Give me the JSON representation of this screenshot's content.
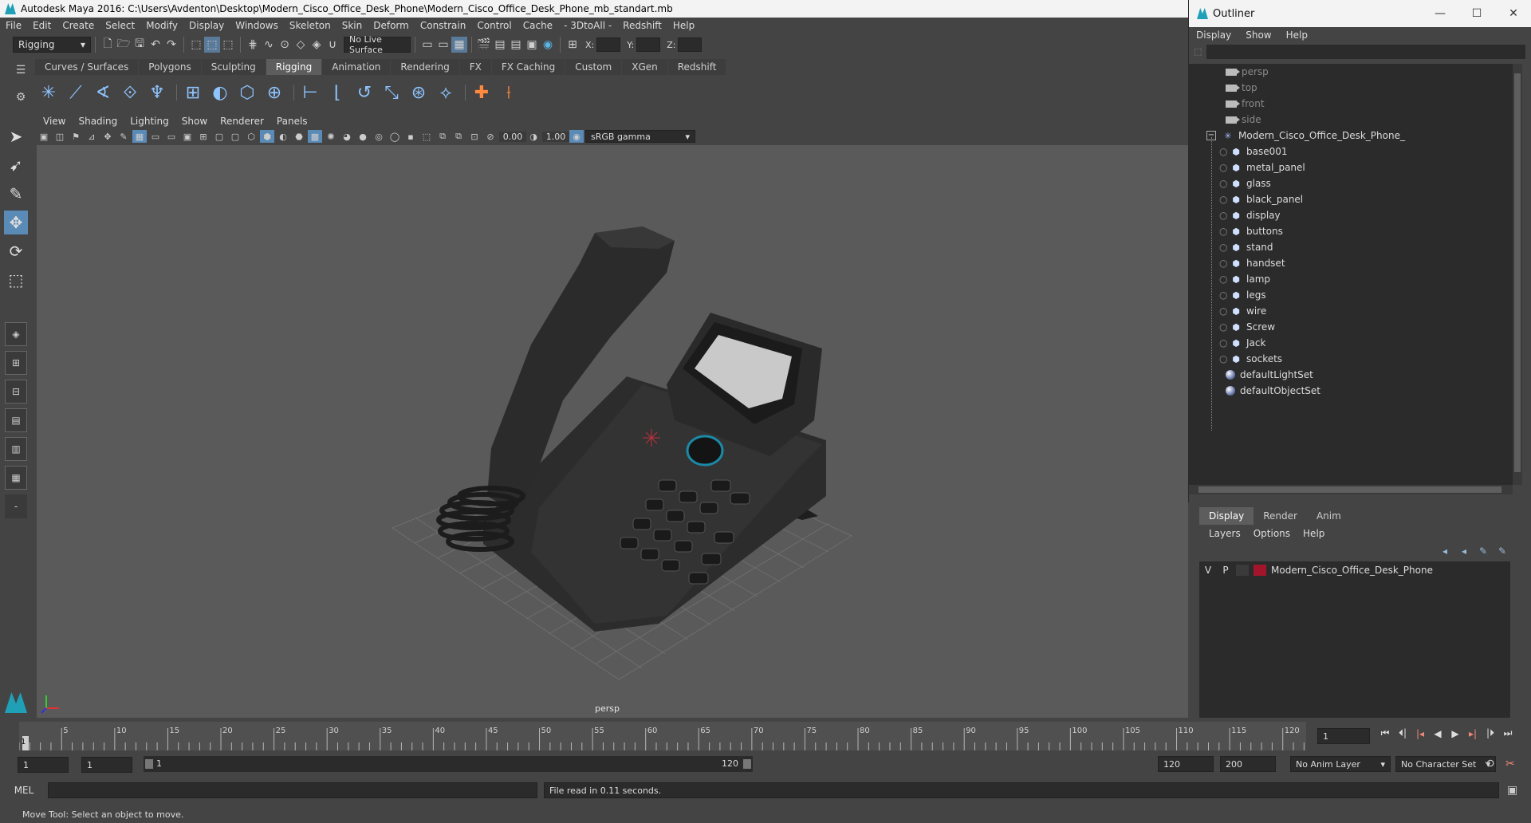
{
  "window": {
    "title": "Autodesk Maya 2016: C:\\Users\\Avdenton\\Desktop\\Modern_Cisco_Office_Desk_Phone\\Modern_Cisco_Office_Desk_Phone_mb_standart.mb"
  },
  "main_menu": [
    "File",
    "Edit",
    "Create",
    "Select",
    "Modify",
    "Display",
    "Windows",
    "Skeleton",
    "Skin",
    "Deform",
    "Constrain",
    "Control",
    "Cache",
    "- 3DtoAll -",
    "Redshift",
    "Help"
  ],
  "status_line": {
    "menu_set": "Rigging",
    "live_surface": "No Live Surface",
    "x_label": "X:",
    "y_label": "Y:",
    "z_label": "Z:"
  },
  "shelf_tabs": [
    "Curves / Surfaces",
    "Polygons",
    "Sculpting",
    "Rigging",
    "Animation",
    "Rendering",
    "FX",
    "FX Caching",
    "Custom",
    "XGen",
    "Redshift"
  ],
  "active_shelf_tab": "Rigging",
  "viewport": {
    "menu": [
      "View",
      "Shading",
      "Lighting",
      "Show",
      "Renderer",
      "Panels"
    ],
    "exposure": "0.00",
    "gamma": "1.00",
    "color_space": "sRGB gamma",
    "camera_label": "persp"
  },
  "outliner": {
    "title": "Outliner",
    "menu": [
      "Display",
      "Show",
      "Help"
    ],
    "cameras": [
      "persp",
      "top",
      "front",
      "side"
    ],
    "group": "Modern_Cisco_Office_Desk_Phone_",
    "children": [
      "base001",
      "metal_panel",
      "glass",
      "black_panel",
      "display",
      "buttons",
      "stand",
      "handset",
      "lamp",
      "legs",
      "wire",
      "Screw",
      "Jack",
      "sockets"
    ],
    "sets": [
      "defaultLightSet",
      "defaultObjectSet"
    ]
  },
  "layer_editor": {
    "tabs": [
      "Display",
      "Render",
      "Anim"
    ],
    "active_tab": "Display",
    "menu": [
      "Layers",
      "Options",
      "Help"
    ],
    "layers": [
      {
        "visible": "V",
        "playback": "P",
        "name": "Modern_Cisco_Office_Desk_Phone",
        "color": "#a3152a"
      }
    ]
  },
  "time_slider": {
    "ticks": [
      "5",
      "10",
      "15",
      "20",
      "25",
      "30",
      "35",
      "40",
      "45",
      "50",
      "55",
      "60",
      "65",
      "70",
      "75",
      "80",
      "85",
      "90",
      "95",
      "100",
      "105",
      "110",
      "115",
      "120"
    ],
    "start_tick": "1",
    "current_frame": "1"
  },
  "range": {
    "start": "1",
    "playback_start": "1",
    "slider_start": "1",
    "slider_end": "120",
    "playback_end": "120",
    "end": "200",
    "anim_layer": "No Anim Layer",
    "character_set": "No Character Set"
  },
  "command_line": {
    "language": "MEL",
    "result": "File read in  0.11 seconds."
  },
  "help_line": "Move Tool: Select an object to move.",
  "colors": {
    "accent": "#5a8ab6",
    "layer_color": "#a3152a",
    "brand": "#1fa0b6"
  }
}
